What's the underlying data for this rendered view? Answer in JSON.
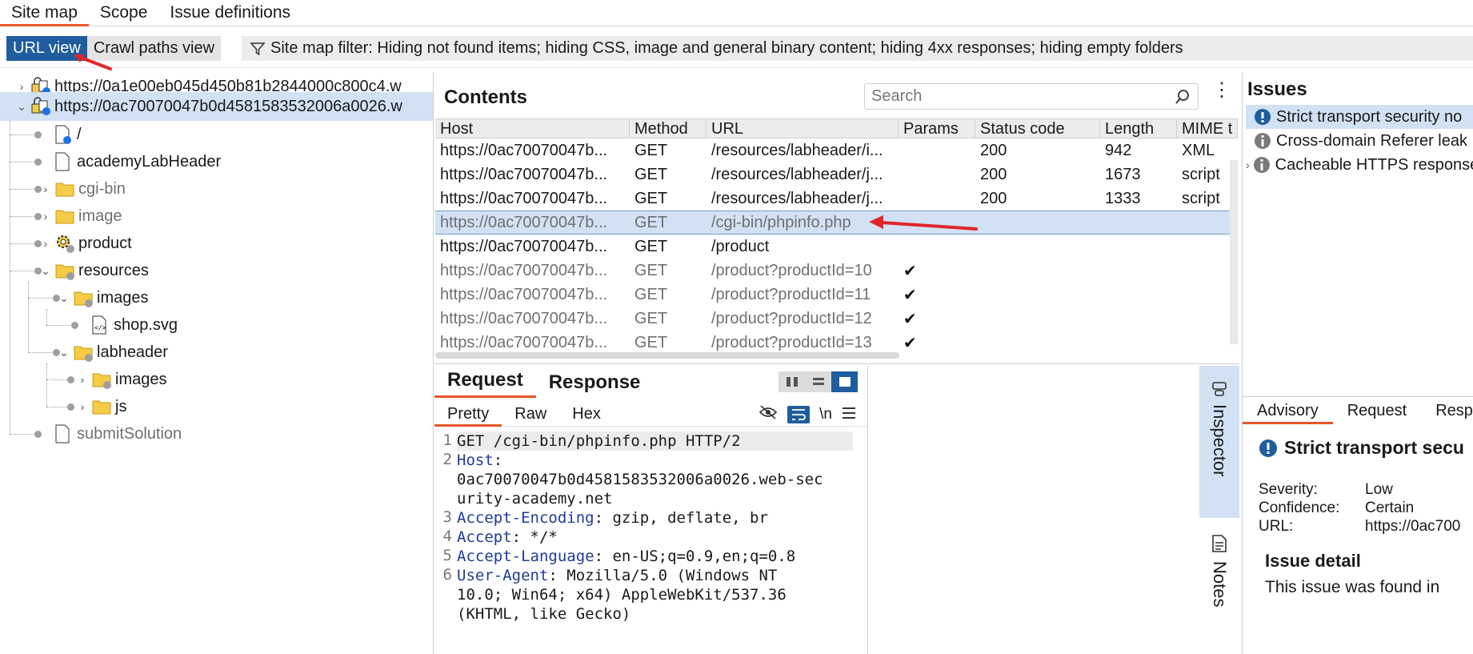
{
  "top_tabs": [
    "Site map",
    "Scope",
    "Issue definitions"
  ],
  "toolbar": {
    "url_view": "URL view",
    "crawl_paths_view": "Crawl paths view",
    "filter_text": "Site map filter: Hiding not found items; hiding CSS, image and general binary content; hiding 4xx responses; hiding empty folders"
  },
  "tree": [
    {
      "label": "https://0a1e00eb045d450b81b2844000c800c4.w",
      "icon": "lock-host-icon"
    },
    {
      "label": "https://0ac70070047b0d4581583532006a0026.w",
      "icon": "lock-host-icon"
    },
    {
      "label": "/",
      "icon": "page-icon"
    },
    {
      "label": "academyLabHeader",
      "icon": "page-icon"
    },
    {
      "label": "cgi-bin",
      "icon": "folder-icon"
    },
    {
      "label": "image",
      "icon": "folder-icon"
    },
    {
      "label": "product",
      "icon": "gear-icon"
    },
    {
      "label": "resources",
      "icon": "folder-icon"
    },
    {
      "label": "images",
      "icon": "folder-icon"
    },
    {
      "label": "shop.svg",
      "icon": "svg-file-icon"
    },
    {
      "label": "labheader",
      "icon": "folder-icon"
    },
    {
      "label": "images",
      "icon": "folder-icon"
    },
    {
      "label": "js",
      "icon": "folder-icon"
    },
    {
      "label": "submitSolution",
      "icon": "page-icon"
    }
  ],
  "contents": {
    "title": "Contents",
    "search_placeholder": "Search",
    "columns": [
      "Host",
      "Method",
      "URL",
      "Params",
      "Status code",
      "Length",
      "MIME t"
    ],
    "rows": [
      {
        "host": "https://0ac70070047b...",
        "method": "GET",
        "url": "/resources/labheader/i...",
        "params": "",
        "status": "200",
        "length": "942",
        "mime": "XML"
      },
      {
        "host": "https://0ac70070047b...",
        "method": "GET",
        "url": "/resources/labheader/j...",
        "params": "",
        "status": "200",
        "length": "1673",
        "mime": "script"
      },
      {
        "host": "https://0ac70070047b...",
        "method": "GET",
        "url": "/resources/labheader/j...",
        "params": "",
        "status": "200",
        "length": "1333",
        "mime": "script"
      },
      {
        "host": "https://0ac70070047b...",
        "method": "GET",
        "url": "/cgi-bin/phpinfo.php",
        "params": "",
        "status": "",
        "length": "",
        "mime": ""
      },
      {
        "host": "https://0ac70070047b...",
        "method": "GET",
        "url": "/product",
        "params": "",
        "status": "",
        "length": "",
        "mime": ""
      },
      {
        "host": "https://0ac70070047b...",
        "method": "GET",
        "url": "/product?productId=10",
        "params": "✔",
        "status": "",
        "length": "",
        "mime": ""
      },
      {
        "host": "https://0ac70070047b...",
        "method": "GET",
        "url": "/product?productId=11",
        "params": "✔",
        "status": "",
        "length": "",
        "mime": ""
      },
      {
        "host": "https://0ac70070047b...",
        "method": "GET",
        "url": "/product?productId=12",
        "params": "✔",
        "status": "",
        "length": "",
        "mime": ""
      },
      {
        "host": "https://0ac70070047b...",
        "method": "GET",
        "url": "/product?productId=13",
        "params": "✔",
        "status": "",
        "length": "",
        "mime": ""
      }
    ]
  },
  "request": {
    "tabs": [
      "Request",
      "Response"
    ],
    "sub_tabs": [
      "Pretty",
      "Raw",
      "Hex"
    ],
    "newline_toggle": "\\n",
    "lines": [
      {
        "no": "1",
        "key": "",
        "text": "GET /cgi-bin/phpinfo.php HTTP/2"
      },
      {
        "no": "2",
        "key": "Host",
        "text": ":"
      },
      {
        "no": "",
        "key": "",
        "text": "0ac70070047b0d4581583532006a0026.web-sec"
      },
      {
        "no": "",
        "key": "",
        "text": "urity-academy.net"
      },
      {
        "no": "3",
        "key": "Accept-Encoding",
        "text": ": gzip, deflate, br"
      },
      {
        "no": "4",
        "key": "Accept",
        "text": ": */*"
      },
      {
        "no": "5",
        "key": "Accept-Language",
        "text": ": en-US;q=0.9,en;q=0.8"
      },
      {
        "no": "6",
        "key": "User-Agent",
        "text": ": Mozilla/5.0 (Windows NT"
      },
      {
        "no": "",
        "key": "",
        "text": "10.0; Win64; x64) AppleWebKit/537.36"
      },
      {
        "no": "",
        "key": "",
        "text": "(KHTML, like Gecko)"
      }
    ]
  },
  "side_tabs": {
    "inspector": "Inspector",
    "notes": "Notes"
  },
  "issues": {
    "title": "Issues",
    "items": [
      {
        "label": "Strict transport security no",
        "severity": "low"
      },
      {
        "label": "Cross-domain Referer leak",
        "severity": "info"
      },
      {
        "label": "Cacheable HTTPS response",
        "severity": "info"
      }
    ]
  },
  "advisory": {
    "tabs": [
      "Advisory",
      "Request",
      "Respo"
    ],
    "title": "Strict transport secu",
    "severity_label": "Severity:",
    "severity_value": "Low",
    "confidence_label": "Confidence:",
    "confidence_value": "Certain",
    "url_label": "URL:",
    "url_value": "https://0ac700",
    "detail_heading": "Issue detail",
    "detail_text": "This issue was found in"
  },
  "colors": {
    "accent": "#e8572b",
    "selected": "#d2e1f4",
    "primary_blue": "#1f5d9f",
    "arrow_red": "#e0262b"
  }
}
